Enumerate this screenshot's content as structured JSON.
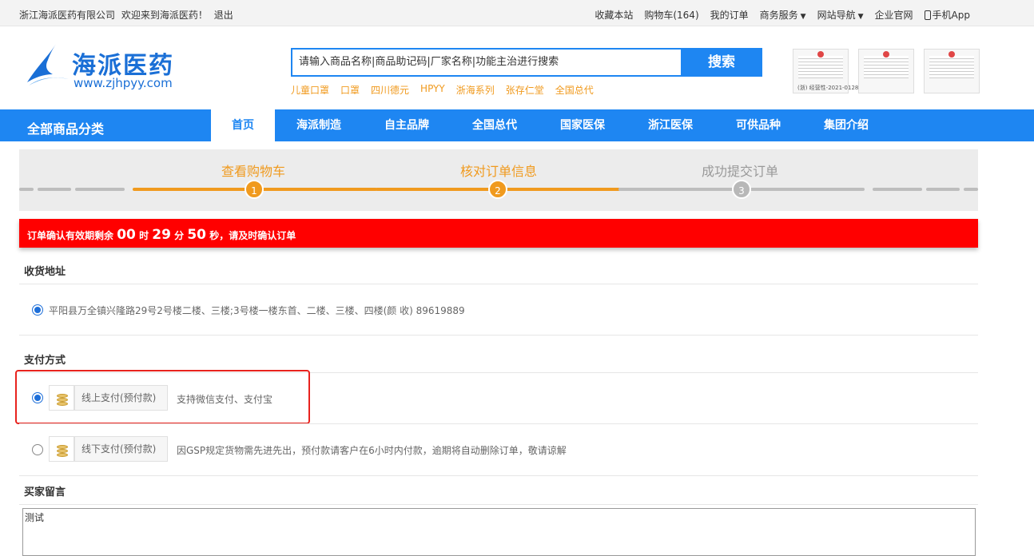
{
  "topbar": {
    "company": "浙江海派医药有限公司",
    "welcome": "欢迎来到海派医药！",
    "logout": "退出",
    "links": [
      "收藏本站",
      "购物车(164)",
      "我的订单",
      "商务服务",
      "网站导航",
      "企业官网",
      "手机App"
    ]
  },
  "logo": {
    "name": "海派医药",
    "url": "www.zjhpyy.com"
  },
  "search": {
    "placeholder": "请输入商品名称|商品助记码|厂家名称|功能主治进行搜索",
    "button": "搜索",
    "hotwords": [
      "儿童口罩",
      "口罩",
      "四川德元",
      "HPYY",
      "浙海系列",
      "张存仁堂",
      "全国总代"
    ]
  },
  "certs": {
    "note": "(浙) 经营性-2021-0128"
  },
  "nav": {
    "all": "全部商品分类",
    "items": [
      "首页",
      "海派制造",
      "自主品牌",
      "全国总代",
      "国家医保",
      "浙江医保",
      "可供品种",
      "集团介绍"
    ]
  },
  "steps": [
    {
      "label": "查看购物车",
      "num": "1",
      "state": "done"
    },
    {
      "label": "核对订单信息",
      "num": "2",
      "state": "current"
    },
    {
      "label": "成功提交订单",
      "num": "3",
      "state": "todo"
    }
  ],
  "timer": {
    "prefix": "订单确认有效期剩余",
    "hours": "00",
    "h_unit": "时",
    "minutes": "29",
    "m_unit": "分",
    "seconds": "50",
    "s_unit": "秒",
    "suffix": "，请及时确认订单"
  },
  "address": {
    "title": "收货地址",
    "text": "平阳县万全镇兴隆路29号2号楼二楼、三楼;3号楼一楼东首、二楼、三楼、四楼(颜 收) 89619889"
  },
  "payment": {
    "title": "支付方式",
    "options": [
      {
        "label": "线上支付(预付款)",
        "desc": "支持微信支付、支付宝",
        "selected": true
      },
      {
        "label": "线下支付(预付款)",
        "desc": "因GSP规定货物需先进先出，预付款请客户在6小时内付款，逾期将自动删除订单，敬请谅解",
        "selected": false
      }
    ]
  },
  "message": {
    "title": "买家留言",
    "value": "测试"
  },
  "colors": {
    "brand_blue": "#1e86f2",
    "step_orange": "#f09a1e",
    "alert_red": "#ff0000"
  }
}
